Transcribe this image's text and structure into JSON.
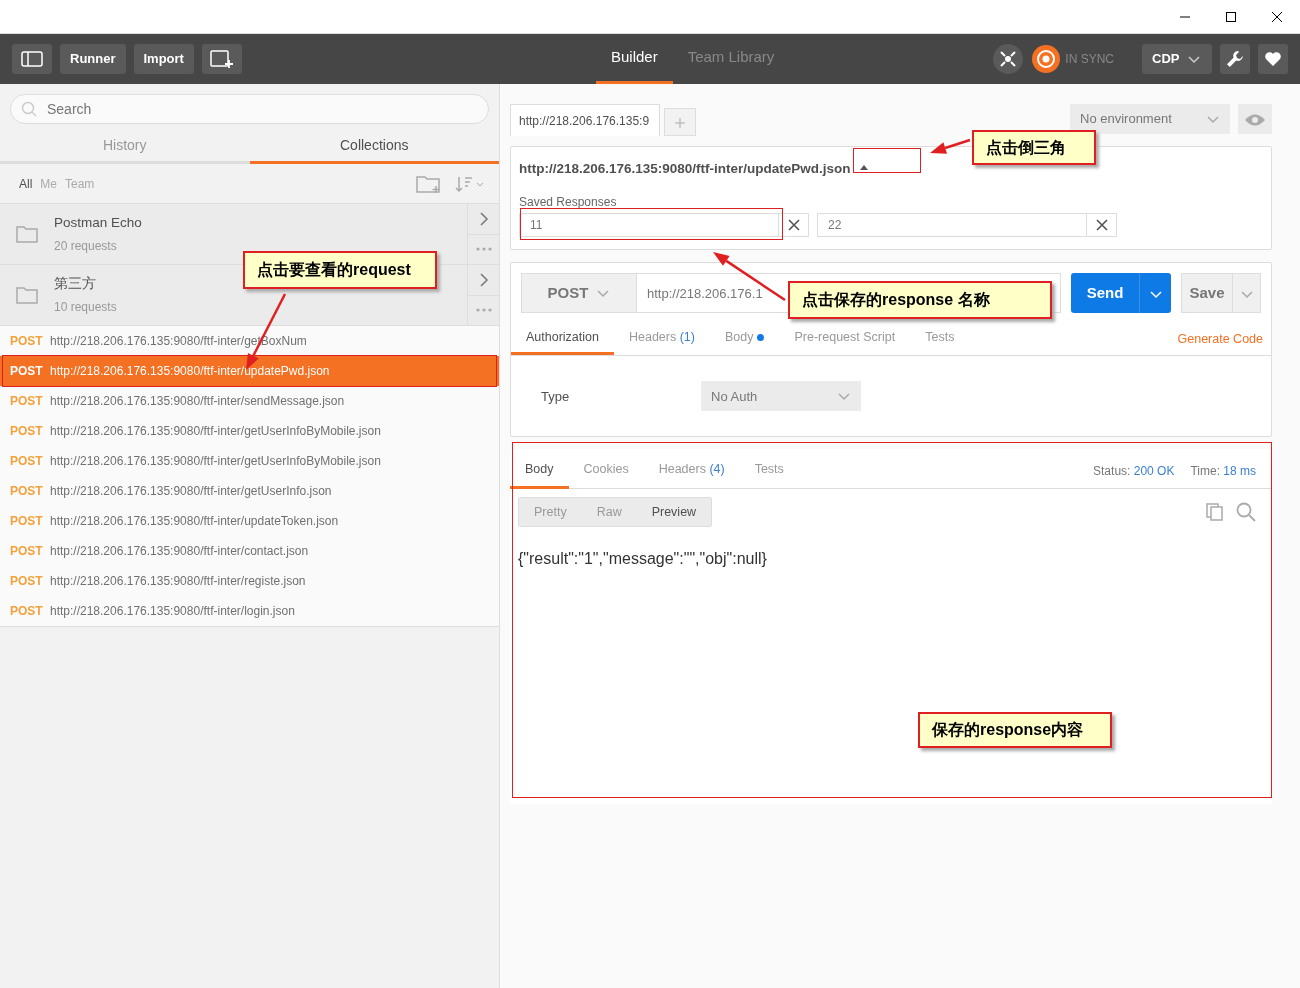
{
  "header": {
    "buttons": [
      "Runner",
      "Import"
    ],
    "tabs": [
      {
        "label": "Builder",
        "selected": true
      },
      {
        "label": "Team Library",
        "selected": false
      }
    ],
    "sync": "IN SYNC",
    "workspace": "CDP"
  },
  "sidebar": {
    "search": {
      "placeholder": "Search"
    },
    "tabs": [
      {
        "label": "History",
        "selected": false
      },
      {
        "label": "Collections",
        "selected": true
      }
    ],
    "filters": [
      {
        "label": "All",
        "selected": true
      },
      {
        "label": "Me",
        "selected": false
      },
      {
        "label": "Team",
        "selected": false
      }
    ],
    "collections": [
      {
        "name": "Postman Echo",
        "count": "20 requests"
      },
      {
        "name": "第三方",
        "count": "10 requests"
      }
    ],
    "requests": [
      {
        "method": "POST",
        "url": "http://218.206.176.135:9080/ftf-inter/getBoxNum",
        "selected": false
      },
      {
        "method": "POST",
        "url": "http://218.206.176.135:9080/ftf-inter/updatePwd.json",
        "selected": true
      },
      {
        "method": "POST",
        "url": "http://218.206.176.135:9080/ftf-inter/sendMessage.json",
        "selected": false
      },
      {
        "method": "POST",
        "url": "http://218.206.176.135:9080/ftf-inter/getUserInfoByMobile.json",
        "selected": false
      },
      {
        "method": "POST",
        "url": "http://218.206.176.135:9080/ftf-inter/getUserInfoByMobile.json",
        "selected": false
      },
      {
        "method": "POST",
        "url": "http://218.206.176.135:9080/ftf-inter/getUserInfo.json",
        "selected": false
      },
      {
        "method": "POST",
        "url": "http://218.206.176.135:9080/ftf-inter/updateToken.json",
        "selected": false
      },
      {
        "method": "POST",
        "url": "http://218.206.176.135:9080/ftf-inter/contact.json",
        "selected": false
      },
      {
        "method": "POST",
        "url": "http://218.206.176.135:9080/ftf-inter/registe.json",
        "selected": false
      },
      {
        "method": "POST",
        "url": "http://218.206.176.135:9080/ftf-inter/login.json",
        "selected": false
      }
    ]
  },
  "request_tabs": [
    {
      "label": "http://218.206.176.135:9",
      "selected": true
    }
  ],
  "environment": "No environment",
  "request": {
    "title": "http://218.206.176.135:9080/ftf-inter/updatePwd.json",
    "expanded": true,
    "saved_responses_label": "Saved Responses",
    "saved_responses": [
      {
        "name": "11"
      },
      {
        "name": "22"
      }
    ],
    "method": "POST",
    "url": "http://218.206.176.1",
    "send": "Send",
    "save": "Save",
    "tabs": [
      {
        "label": "Authorization",
        "dot": false,
        "selected": true
      },
      {
        "label": "Headers",
        "count": "(1)",
        "dot": false,
        "selected": false
      },
      {
        "label": "Body",
        "dot": true,
        "selected": false
      },
      {
        "label": "Pre-request Script",
        "dot": false,
        "selected": false
      },
      {
        "label": "Tests",
        "dot": false,
        "selected": false
      }
    ],
    "generate_code": "Generate Code",
    "auth_type_label": "Type",
    "auth_type": "No Auth"
  },
  "response": {
    "tabs": [
      {
        "label": "Body",
        "selected": true
      },
      {
        "label": "Cookies",
        "selected": false
      },
      {
        "label": "Headers",
        "count": "(4)",
        "selected": false
      },
      {
        "label": "Tests",
        "selected": false
      }
    ],
    "status_label": "Status:",
    "status": "200 OK",
    "time_label": "Time:",
    "time": "18 ms",
    "views": [
      {
        "label": "Pretty",
        "selected": false
      },
      {
        "label": "Raw",
        "selected": false
      },
      {
        "label": "Preview",
        "selected": true
      }
    ],
    "body": "{\"result\":\"1\",\"message\":\"\",\"obj\":null}"
  },
  "annotations": [
    {
      "text": "点击要查看的request"
    },
    {
      "text": "点击倒三角"
    },
    {
      "text": "点击保存的response 名称"
    },
    {
      "text": "保存的response内容"
    }
  ]
}
